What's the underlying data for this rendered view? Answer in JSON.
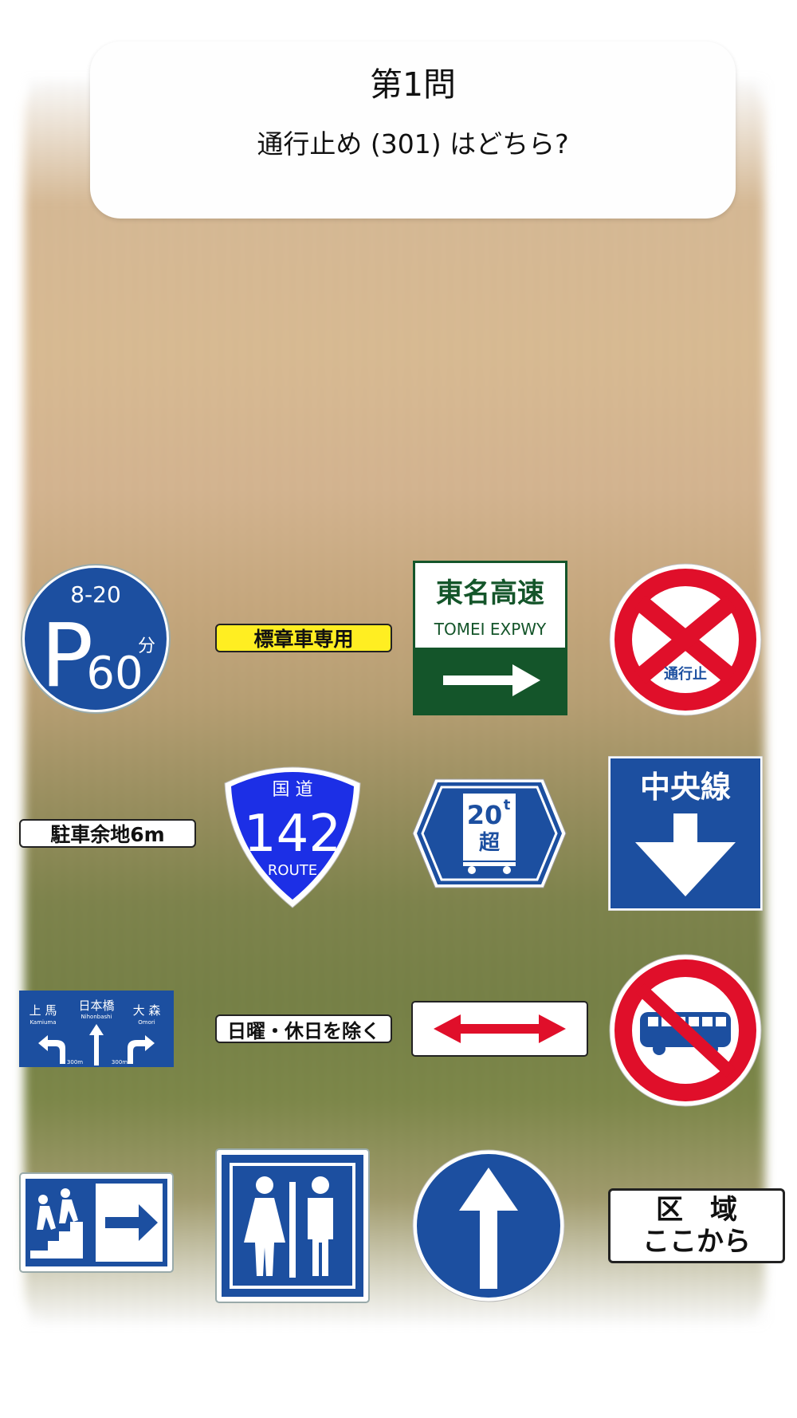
{
  "question": {
    "number_label": "第1問",
    "prompt": "通行止め (301) はどちら?"
  },
  "signs": {
    "parking_60": {
      "top_text": "8-20",
      "letter": "P",
      "minutes": "60",
      "unit": "分"
    },
    "marked_vehicle_only": {
      "text": "標章車専用"
    },
    "tomei": {
      "jp": "東名高速",
      "en": "TOMEI EXPWY"
    },
    "road_closed": {
      "text": "通行止"
    },
    "parking_space_6m": {
      "text": "駐車余地6m"
    },
    "route_142": {
      "top": "国 道",
      "number": "142",
      "bottom": "ROUTE"
    },
    "weight_20t": {
      "value": "20",
      "unit": "t",
      "suffix": "超"
    },
    "center_line": {
      "text": "中央線"
    },
    "guide_sign": {
      "left_jp": "上 馬",
      "left_en": "Kamiuma",
      "mid_jp": "日本橋",
      "mid_en": "Nihonbashi",
      "right_jp": "大 森",
      "right_en": "Omori",
      "dist_left": "300m",
      "dist_right": "300m"
    },
    "except_holidays": {
      "text": "日曜・休日を除く"
    },
    "zone_start": {
      "line1": "区　域",
      "line2": "ここから"
    }
  },
  "colors": {
    "sign_blue": "#1c4fa0",
    "sign_red": "#e00f2a",
    "expressway_green": "#14552a",
    "route_blue": "#1c2fe6",
    "label_yellow": "#ffee22"
  },
  "icons": [
    "parking-sign-icon",
    "road-closed-sign-icon",
    "route-shield-icon",
    "weight-limit-sign-icon",
    "no-bus-sign-icon",
    "two-way-arrow-icon",
    "pedestrian-stairs-icon",
    "restroom-icon",
    "one-way-up-icon"
  ]
}
